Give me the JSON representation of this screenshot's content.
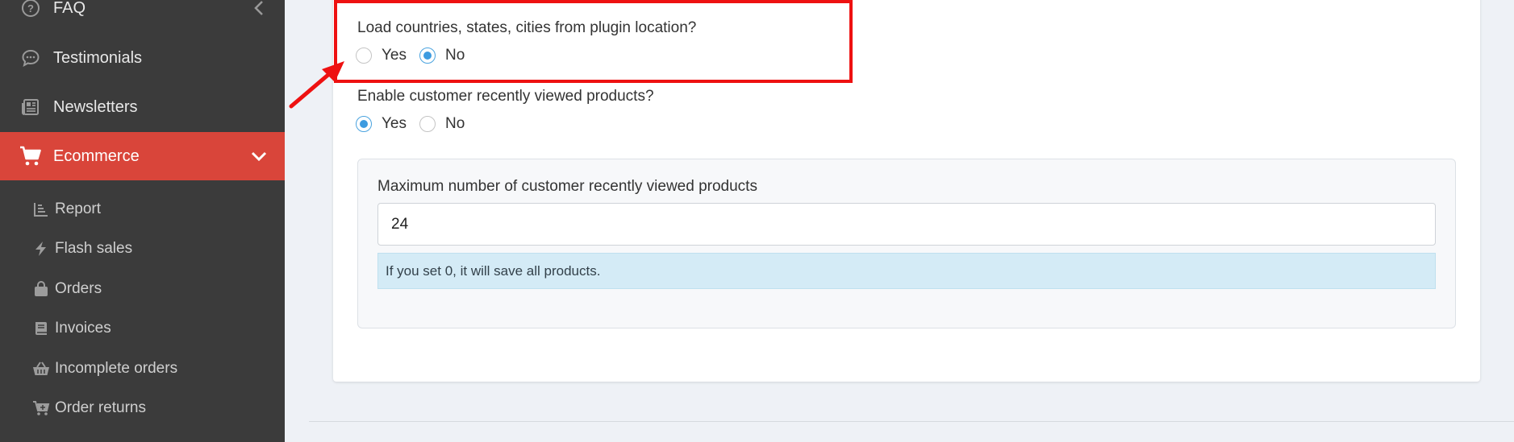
{
  "sidebar": {
    "items": [
      {
        "label": "FAQ",
        "icon": "question-circle-icon"
      },
      {
        "label": "Testimonials",
        "icon": "chat-bubble-icon"
      },
      {
        "label": "Newsletters",
        "icon": "newspaper-icon"
      },
      {
        "label": "Ecommerce",
        "icon": "shopping-cart-icon",
        "active": true
      }
    ],
    "subitems": [
      {
        "label": "Report",
        "icon": "chart-icon"
      },
      {
        "label": "Flash sales",
        "icon": "bolt-icon"
      },
      {
        "label": "Orders",
        "icon": "shopping-bag-icon"
      },
      {
        "label": "Invoices",
        "icon": "book-icon"
      },
      {
        "label": "Incomplete orders",
        "icon": "basket-icon"
      },
      {
        "label": "Order returns",
        "icon": "cart-return-icon"
      }
    ],
    "active_color": "#d9453a",
    "background_color": "#3b3b3b"
  },
  "settings": {
    "load_location": {
      "question": "Load countries, states, cities from plugin location?",
      "options": [
        "Yes",
        "No"
      ],
      "selected": "No"
    },
    "recently_viewed": {
      "question": "Enable customer recently viewed products?",
      "options": [
        "Yes",
        "No"
      ],
      "selected": "Yes"
    },
    "max_recently_viewed": {
      "label": "Maximum number of customer recently viewed products",
      "value": "24",
      "help": "If you set 0, it will save all products."
    }
  },
  "annotation": {
    "highlight_color": "#ee1111"
  }
}
